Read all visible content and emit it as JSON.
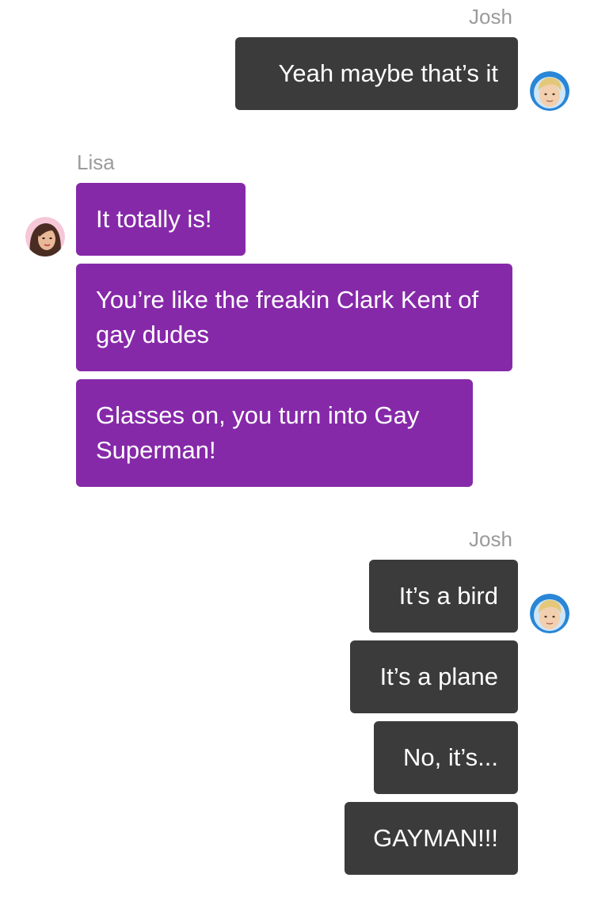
{
  "conversation": {
    "groups": [
      {
        "sender": "Josh",
        "direction": "outgoing",
        "messages": [
          "Yeah maybe that’s it"
        ]
      },
      {
        "sender": "Lisa",
        "direction": "incoming",
        "messages": [
          "It totally is!",
          "You’re like the freakin Clark Kent of gay dudes",
          "Glasses on, you turn into Gay Superman!"
        ]
      },
      {
        "sender": "Josh",
        "direction": "outgoing",
        "messages": [
          "It’s a bird",
          "It’s a plane",
          "No, it’s...",
          "GAYMAN!!!"
        ]
      }
    ]
  },
  "avatars": {
    "josh": {
      "icon": "josh-avatar-icon",
      "ring_color": "#2a86d6",
      "hair_color": "#e4c87a"
    },
    "lisa": {
      "icon": "lisa-avatar-icon",
      "hair_color": "#4a2c22",
      "ring_color": "#f6c7d6"
    }
  },
  "colors": {
    "outgoing_bubble": "#3b3b3b",
    "incoming_bubble": "#8629a9",
    "sender_name": "#9b9b9b"
  }
}
